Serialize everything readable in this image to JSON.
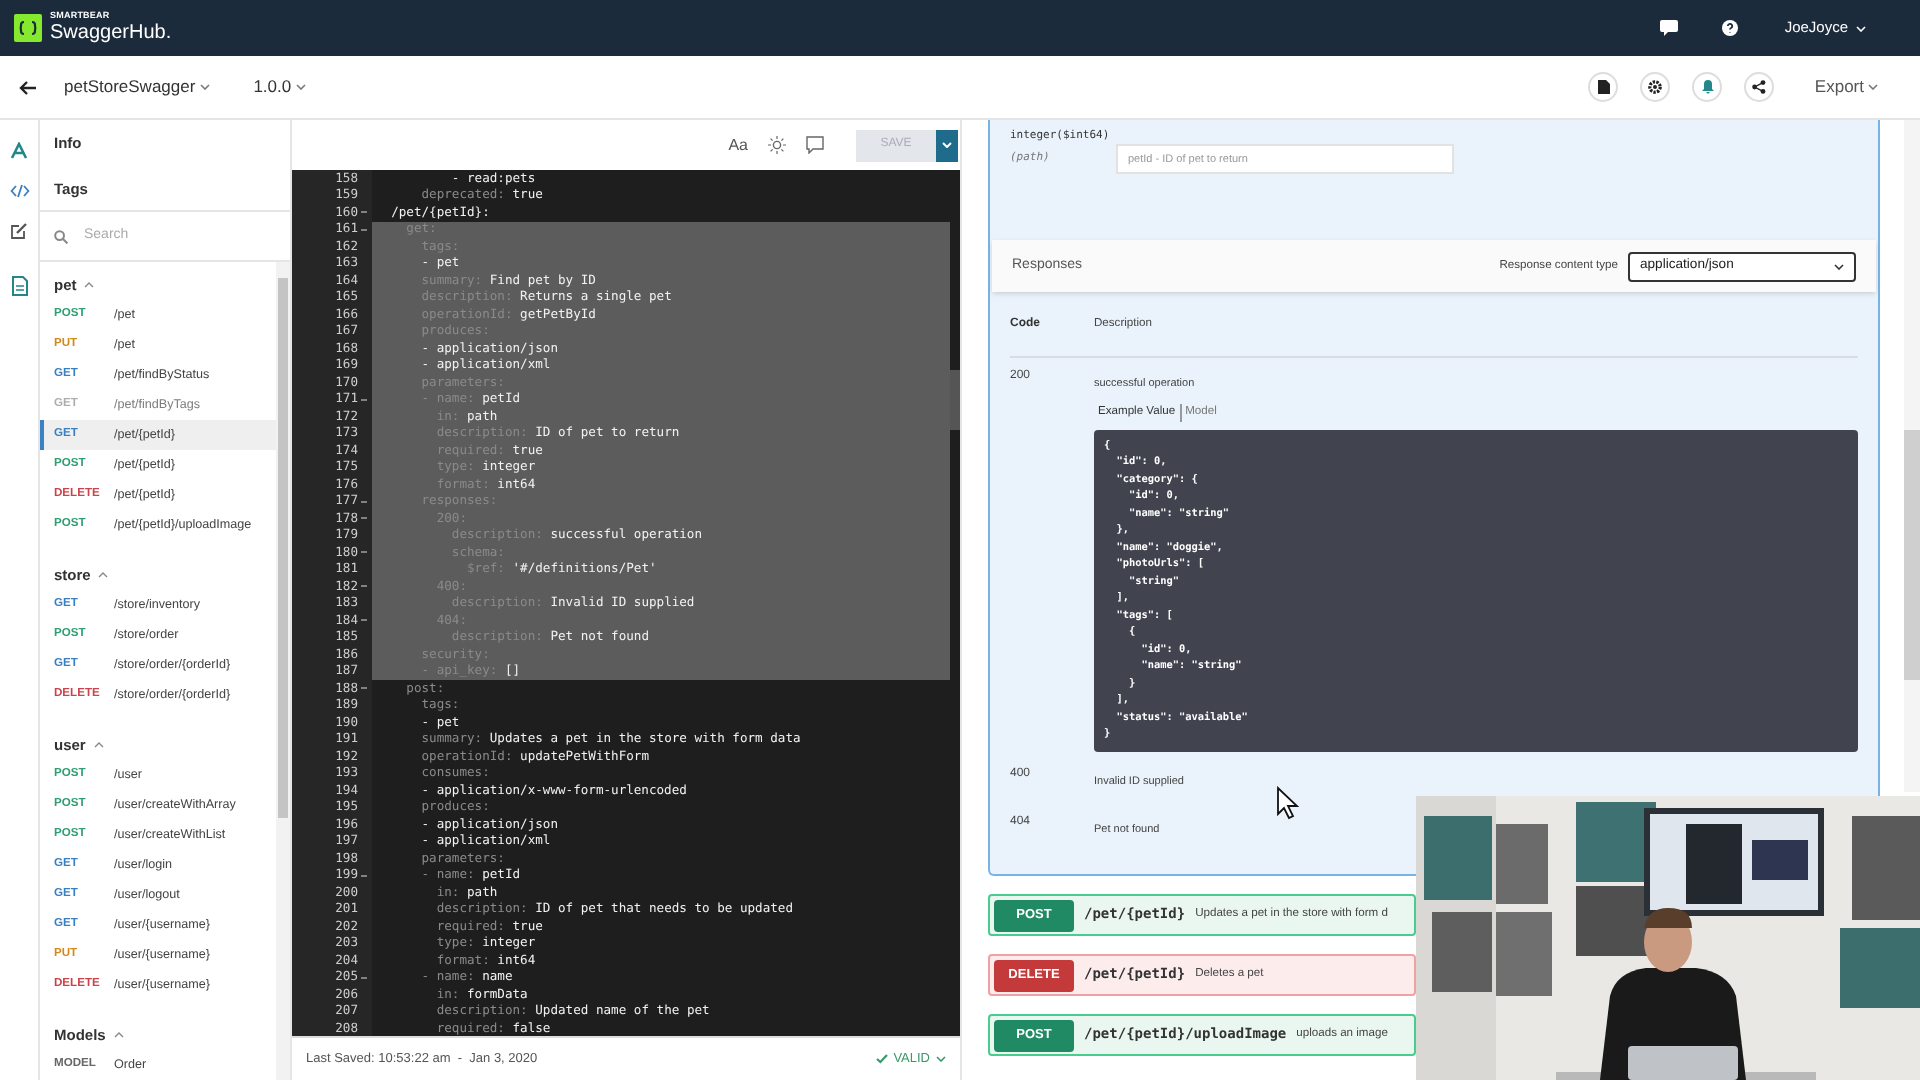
{
  "header": {
    "brand_small": "SMARTBEAR",
    "brand": "SwaggerHub.",
    "user": "JoeJoyce"
  },
  "toolbar": {
    "api_name": "petStoreSwagger",
    "version": "1.0.0",
    "export": "Export"
  },
  "sidebar": {
    "info": "Info",
    "tags": "Tags",
    "search": {
      "placeholder": "Search"
    },
    "groups": [
      {
        "name": "pet",
        "expanded": true,
        "items": [
          {
            "method": "POST",
            "path": "/pet",
            "selected": false,
            "deprecated": false
          },
          {
            "method": "PUT",
            "path": "/pet",
            "selected": false,
            "deprecated": false
          },
          {
            "method": "GET",
            "path": "/pet/findByStatus",
            "selected": false,
            "deprecated": false
          },
          {
            "method": "GET",
            "path": "/pet/findByTags",
            "selected": false,
            "deprecated": true
          },
          {
            "method": "GET",
            "path": "/pet/{petId}",
            "selected": true,
            "deprecated": false
          },
          {
            "method": "POST",
            "path": "/pet/{petId}",
            "selected": false,
            "deprecated": false
          },
          {
            "method": "DELETE",
            "path": "/pet/{petId}",
            "selected": false,
            "deprecated": false
          },
          {
            "method": "POST",
            "path": "/pet/{petId}/uploadImage",
            "selected": false,
            "deprecated": false
          }
        ]
      },
      {
        "name": "store",
        "expanded": true,
        "items": [
          {
            "method": "GET",
            "path": "/store/inventory",
            "selected": false,
            "deprecated": false
          },
          {
            "method": "POST",
            "path": "/store/order",
            "selected": false,
            "deprecated": false
          },
          {
            "method": "GET",
            "path": "/store/order/{orderId}",
            "selected": false,
            "deprecated": false
          },
          {
            "method": "DELETE",
            "path": "/store/order/{orderId}",
            "selected": false,
            "deprecated": false
          }
        ]
      },
      {
        "name": "user",
        "expanded": true,
        "items": [
          {
            "method": "POST",
            "path": "/user",
            "selected": false,
            "deprecated": false
          },
          {
            "method": "POST",
            "path": "/user/createWithArray",
            "selected": false,
            "deprecated": false
          },
          {
            "method": "POST",
            "path": "/user/createWithList",
            "selected": false,
            "deprecated": false
          },
          {
            "method": "GET",
            "path": "/user/login",
            "selected": false,
            "deprecated": false
          },
          {
            "method": "GET",
            "path": "/user/logout",
            "selected": false,
            "deprecated": false
          },
          {
            "method": "GET",
            "path": "/user/{username}",
            "selected": false,
            "deprecated": false
          },
          {
            "method": "PUT",
            "path": "/user/{username}",
            "selected": false,
            "deprecated": false
          },
          {
            "method": "DELETE",
            "path": "/user/{username}",
            "selected": false,
            "deprecated": false
          }
        ]
      },
      {
        "name": "Models",
        "expanded": true,
        "items": [
          {
            "method": "MODEL",
            "path": "Order",
            "selected": false,
            "deprecated": false
          }
        ]
      }
    ]
  },
  "editor": {
    "font_button": "Aa",
    "save": "SAVE",
    "save_disabled": true,
    "lines": [
      {
        "number": "158",
        "value": "          - read:pets",
        "fold": false,
        "selected": false
      },
      {
        "number": "159",
        "key": "      deprecated:",
        "value": " true",
        "fold": false,
        "selected": false
      },
      {
        "number": "160",
        "value": "  /pet/{petId}:",
        "fold": true,
        "selected": false
      },
      {
        "number": "161",
        "key": "    get:",
        "fold": true,
        "selected": true
      },
      {
        "number": "162",
        "key": "      tags:",
        "fold": false,
        "selected": true
      },
      {
        "number": "163",
        "value": "      - pet",
        "fold": false,
        "selected": true
      },
      {
        "number": "164",
        "key": "      summary:",
        "value": " Find pet by ID",
        "fold": false,
        "selected": true
      },
      {
        "number": "165",
        "key": "      description:",
        "value": " Returns a single pet",
        "fold": false,
        "selected": true
      },
      {
        "number": "166",
        "key": "      operationId:",
        "value": " getPetById",
        "fold": false,
        "selected": true
      },
      {
        "number": "167",
        "key": "      produces:",
        "fold": false,
        "selected": true
      },
      {
        "number": "168",
        "value": "      - application/json",
        "fold": false,
        "selected": true
      },
      {
        "number": "169",
        "value": "      - application/xml",
        "fold": false,
        "selected": true
      },
      {
        "number": "170",
        "key": "      parameters:",
        "fold": false,
        "selected": true
      },
      {
        "number": "171",
        "key": "      - name:",
        "value": " petId",
        "fold": true,
        "selected": true
      },
      {
        "number": "172",
        "key": "        in:",
        "value": " path",
        "fold": false,
        "selected": true
      },
      {
        "number": "173",
        "key": "        description:",
        "value": " ID of pet to return",
        "fold": false,
        "selected": true
      },
      {
        "number": "174",
        "key": "        required:",
        "value": " true",
        "fold": false,
        "selected": true
      },
      {
        "number": "175",
        "key": "        type:",
        "value": " integer",
        "fold": false,
        "selected": true
      },
      {
        "number": "176",
        "key": "        format:",
        "value": " int64",
        "fold": false,
        "selected": true
      },
      {
        "number": "177",
        "key": "      responses:",
        "fold": true,
        "selected": true
      },
      {
        "number": "178",
        "key": "        200:",
        "fold": true,
        "selected": true
      },
      {
        "number": "179",
        "key": "          description:",
        "value": " successful operation",
        "fold": false,
        "selected": true
      },
      {
        "number": "180",
        "key": "          schema:",
        "fold": true,
        "selected": true
      },
      {
        "number": "181",
        "key": "            $ref:",
        "value": " '#/definitions/Pet'",
        "fold": false,
        "selected": true
      },
      {
        "number": "182",
        "key": "        400:",
        "fold": true,
        "selected": true
      },
      {
        "number": "183",
        "key": "          description:",
        "value": " Invalid ID supplied",
        "fold": false,
        "selected": true
      },
      {
        "number": "184",
        "key": "        404:",
        "fold": true,
        "selected": true
      },
      {
        "number": "185",
        "key": "          description:",
        "value": " Pet not found",
        "fold": false,
        "selected": true
      },
      {
        "number": "186",
        "key": "      security:",
        "fold": false,
        "selected": true
      },
      {
        "number": "187",
        "key": "      - api_key:",
        "value": " []",
        "fold": false,
        "selected": true
      },
      {
        "number": "188",
        "key": "    post:",
        "fold": true,
        "selected": false
      },
      {
        "number": "189",
        "key": "      tags:",
        "fold": false,
        "selected": false
      },
      {
        "number": "190",
        "value": "      - pet",
        "fold": false,
        "selected": false
      },
      {
        "number": "191",
        "key": "      summary:",
        "value": " Updates a pet in the store with form data",
        "fold": false,
        "selected": false
      },
      {
        "number": "192",
        "key": "      operationId:",
        "value": " updatePetWithForm",
        "fold": false,
        "selected": false
      },
      {
        "number": "193",
        "key": "      consumes:",
        "fold": false,
        "selected": false
      },
      {
        "number": "194",
        "value": "      - application/x-www-form-urlencoded",
        "fold": false,
        "selected": false
      },
      {
        "number": "195",
        "key": "      produces:",
        "fold": false,
        "selected": false
      },
      {
        "number": "196",
        "value": "      - application/json",
        "fold": false,
        "selected": false
      },
      {
        "number": "197",
        "value": "      - application/xml",
        "fold": false,
        "selected": false
      },
      {
        "number": "198",
        "key": "      parameters:",
        "fold": false,
        "selected": false
      },
      {
        "number": "199",
        "key": "      - name:",
        "value": " petId",
        "fold": true,
        "selected": false
      },
      {
        "number": "200",
        "key": "        in:",
        "value": " path",
        "fold": false,
        "selected": false
      },
      {
        "number": "201",
        "key": "        description:",
        "value": " ID of pet that needs to be updated",
        "fold": false,
        "selected": false
      },
      {
        "number": "202",
        "key": "        required:",
        "value": " true",
        "fold": false,
        "selected": false
      },
      {
        "number": "203",
        "key": "        type:",
        "value": " integer",
        "fold": false,
        "selected": false
      },
      {
        "number": "204",
        "key": "        format:",
        "value": " int64",
        "fold": false,
        "selected": false
      },
      {
        "number": "205",
        "key": "      - name:",
        "value": " name",
        "fold": true,
        "selected": false
      },
      {
        "number": "206",
        "key": "        in:",
        "value": " formData",
        "fold": false,
        "selected": false
      },
      {
        "number": "207",
        "key": "        description:",
        "value": " Updated name of the pet",
        "fold": false,
        "selected": false
      },
      {
        "number": "208",
        "key": "        required:",
        "value": " false",
        "fold": false,
        "selected": false
      }
    ],
    "status": {
      "last_saved": "Last Saved: 10:53:22 am  -  Jan 3, 2020",
      "valid": "VALID"
    }
  },
  "operation": {
    "param_type": "integer($int64)",
    "param_in": "(path)",
    "param_input": {
      "placeholder": "petId - ID of pet to return"
    },
    "responses_title": "Responses",
    "content_type_label": "Response content type",
    "content_type": "application/json",
    "columns": [
      "Code",
      "Description"
    ],
    "responses": [
      {
        "code": "200",
        "description": "successful operation",
        "tabs": [
          {
            "label": "Example Value",
            "selected": true
          },
          {
            "label": "Model",
            "selected": false
          }
        ],
        "example": [
          "{",
          "  \"id\": 0,",
          "  \"category\": {",
          "    \"id\": 0,",
          "    \"name\": \"string\"",
          "  },",
          "  \"name\": \"doggie\",",
          "  \"photoUrls\": [",
          "    \"string\"",
          "  ],",
          "  \"tags\": [",
          "    {",
          "      \"id\": 0,",
          "      \"name\": \"string\"",
          "    }",
          "  ],",
          "  \"status\": \"available\"",
          "}"
        ]
      },
      {
        "code": "400",
        "description": "Invalid ID supplied"
      },
      {
        "code": "404",
        "description": "Pet not found"
      }
    ]
  },
  "operations": [
    {
      "method": "POST",
      "path": "/pet/{petId}",
      "summary": "Updates a pet in the store with form d"
    },
    {
      "method": "DELETE",
      "path": "/pet/{petId}",
      "summary": "Deletes a pet"
    },
    {
      "method": "POST",
      "path": "/pet/{petId}/uploadImage",
      "summary": "uploads an image"
    }
  ]
}
